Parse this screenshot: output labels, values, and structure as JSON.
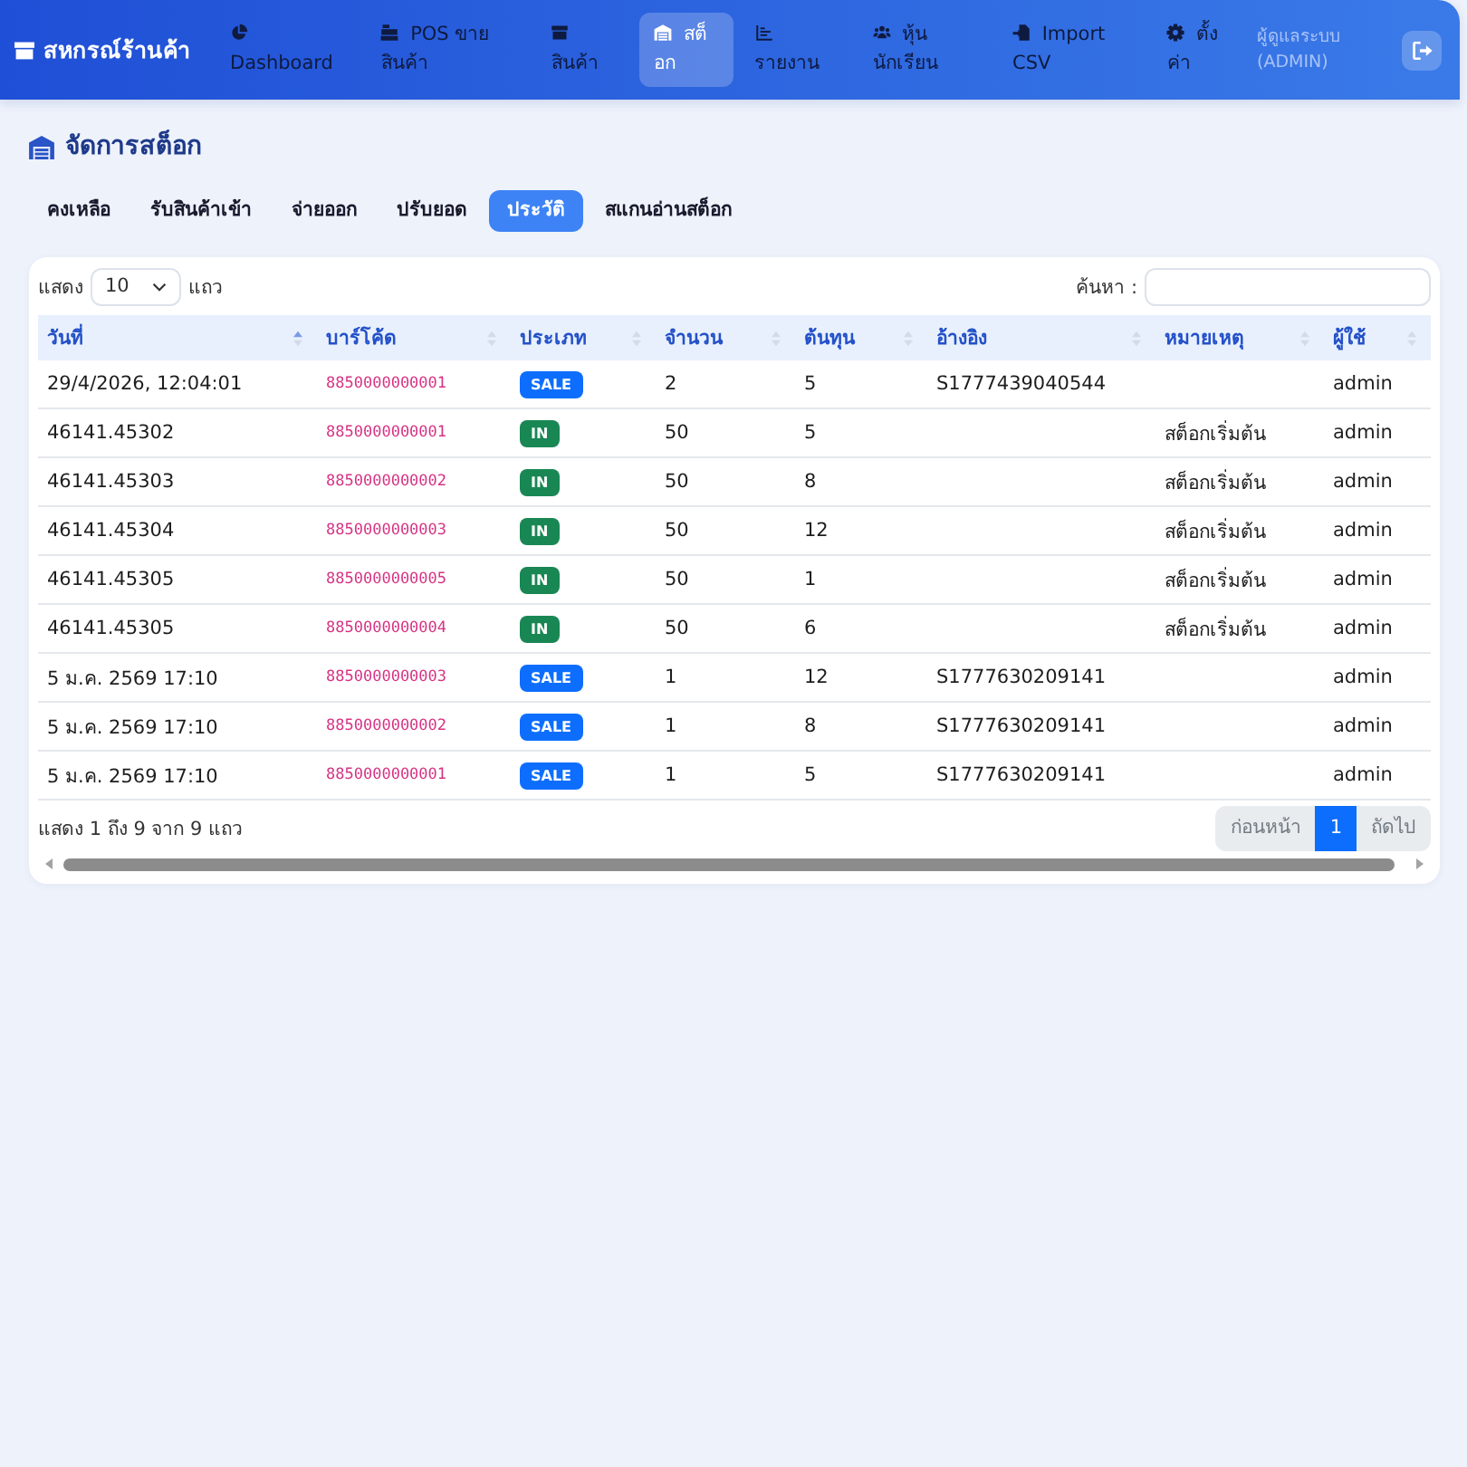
{
  "navbar": {
    "brand": "สหกรณ์ร้านค้า",
    "items": [
      {
        "label": "Dashboard",
        "selected": false
      },
      {
        "label": "POS ขายสินค้า",
        "selected": false
      },
      {
        "label": "สินค้า",
        "selected": false
      },
      {
        "label": "สต็อก",
        "selected": true
      },
      {
        "label": "รายงาน",
        "selected": false
      },
      {
        "label": "หุ้นนักเรียน",
        "selected": false
      },
      {
        "label": "Import CSV",
        "selected": false
      },
      {
        "label": "ตั้งค่า",
        "selected": false
      }
    ],
    "user": "ผู้ดูแลระบบ (ADMIN)"
  },
  "page": {
    "title": "จัดการสต็อก",
    "tabs": [
      {
        "label": "คงเหลือ",
        "selected": false
      },
      {
        "label": "รับสินค้าเข้า",
        "selected": false
      },
      {
        "label": "จ่ายออก",
        "selected": false
      },
      {
        "label": "ปรับยอด",
        "selected": false
      },
      {
        "label": "ประวัติ",
        "selected": true
      },
      {
        "label": "สแกนอ่านสต็อก",
        "selected": false
      }
    ]
  },
  "table_controls": {
    "show_label": "แสดง",
    "page_size": "10",
    "rows_label": "แถว",
    "search_label": "ค้นหา :"
  },
  "table": {
    "columns": [
      {
        "label": "วันที่",
        "sorted": true
      },
      {
        "label": "บาร์โค้ด",
        "sorted": false
      },
      {
        "label": "ประเภท",
        "sorted": false
      },
      {
        "label": "จำนวน",
        "sorted": false
      },
      {
        "label": "ต้นทุน",
        "sorted": false
      },
      {
        "label": "อ้างอิง",
        "sorted": false
      },
      {
        "label": "หมายเหตุ",
        "sorted": false
      },
      {
        "label": "ผู้ใช้",
        "sorted": false
      }
    ],
    "rows": [
      {
        "date": "29/4/2026, 12:04:01",
        "barcode": "8850000000001",
        "type": {
          "label": "SALE",
          "color": "#0d6efd"
        },
        "quantity": "2",
        "cost": "5",
        "reference": "S1777439040544",
        "user": "admin"
      },
      {
        "date": "46141.45302",
        "barcode": "8850000000001",
        "type": {
          "label": "IN",
          "color": "#198754"
        },
        "quantity": "50",
        "cost": "5",
        "note": "สต็อกเริ่มต้น",
        "user": "admin"
      },
      {
        "date": "46141.45303",
        "barcode": "8850000000002",
        "type": {
          "label": "IN",
          "color": "#198754"
        },
        "quantity": "50",
        "cost": "8",
        "note": "สต็อกเริ่มต้น",
        "user": "admin"
      },
      {
        "date": "46141.45304",
        "barcode": "8850000000003",
        "type": {
          "label": "IN",
          "color": "#198754"
        },
        "quantity": "50",
        "cost": "12",
        "note": "สต็อกเริ่มต้น",
        "user": "admin"
      },
      {
        "date": "46141.45305",
        "barcode": "8850000000005",
        "type": {
          "label": "IN",
          "color": "#198754"
        },
        "quantity": "50",
        "cost": "1",
        "note": "สต็อกเริ่มต้น",
        "user": "admin"
      },
      {
        "date": "46141.45305",
        "barcode": "8850000000004",
        "type": {
          "label": "IN",
          "color": "#198754"
        },
        "quantity": "50",
        "cost": "6",
        "note": "สต็อกเริ่มต้น",
        "user": "admin"
      },
      {
        "date": "5 ม.ค. 2569 17:10",
        "barcode": "8850000000003",
        "type": {
          "label": "SALE",
          "color": "#0d6efd"
        },
        "quantity": "1",
        "cost": "12",
        "reference": "S1777630209141",
        "user": "admin"
      },
      {
        "date": "5 ม.ค. 2569 17:10",
        "barcode": "8850000000002",
        "type": {
          "label": "SALE",
          "color": "#0d6efd"
        },
        "quantity": "1",
        "cost": "8",
        "reference": "S1777630209141",
        "user": "admin"
      },
      {
        "date": "5 ม.ค. 2569 17:10",
        "barcode": "8850000000001",
        "type": {
          "label": "SALE",
          "color": "#0d6efd"
        },
        "quantity": "1",
        "cost": "5",
        "reference": "S1777630209141",
        "user": "admin"
      }
    ]
  },
  "footer": {
    "info": "แสดง 1 ถึง 9 จาก 9 แถว",
    "pagination": [
      {
        "label": "ก่อนหน้า",
        "selected": false,
        "disabled": true
      },
      {
        "label": "1",
        "selected": true,
        "disabled": false
      },
      {
        "label": "ถัดไป",
        "selected": false,
        "disabled": true
      }
    ]
  }
}
